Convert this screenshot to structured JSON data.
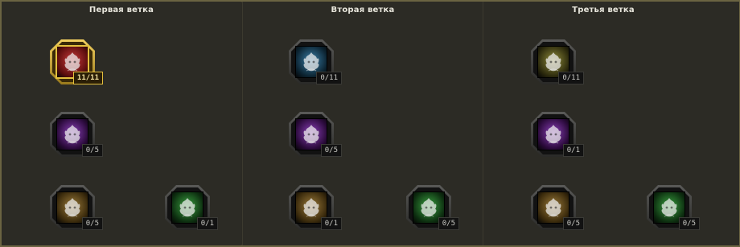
{
  "branches": [
    {
      "title": "Первая ветка"
    },
    {
      "title": "Вторая ветка"
    },
    {
      "title": "Третья ветка"
    }
  ],
  "nodes": [
    {
      "counter": "11/11",
      "theme": "red"
    },
    {
      "counter": "0/5",
      "theme": "purple"
    },
    {
      "counter": "0/5",
      "theme": "brown"
    },
    {
      "counter": "0/1",
      "theme": "green"
    },
    {
      "counter": "0/11",
      "theme": "blue"
    },
    {
      "counter": "0/5",
      "theme": "purple"
    },
    {
      "counter": "0/1",
      "theme": "brown"
    },
    {
      "counter": "0/5",
      "theme": "green"
    },
    {
      "counter": "0/11",
      "theme": "olive"
    },
    {
      "counter": "0/1",
      "theme": "purple"
    },
    {
      "counter": "0/5",
      "theme": "brown"
    },
    {
      "counter": "0/5",
      "theme": "green"
    }
  ],
  "colors": {
    "red": [
      "#c83a3a",
      "#5a0d0d"
    ],
    "purple": [
      "#8a3fb8",
      "#2a0a3a"
    ],
    "brown": [
      "#9a7a3a",
      "#3a2a0c"
    ],
    "green": [
      "#3aa040",
      "#0d2f10"
    ],
    "blue": [
      "#3a7fa8",
      "#0c2432"
    ],
    "olive": [
      "#8f8b3a",
      "#2c2a0d"
    ]
  },
  "icons": {
    "skill": "flame-sprite-icon"
  }
}
